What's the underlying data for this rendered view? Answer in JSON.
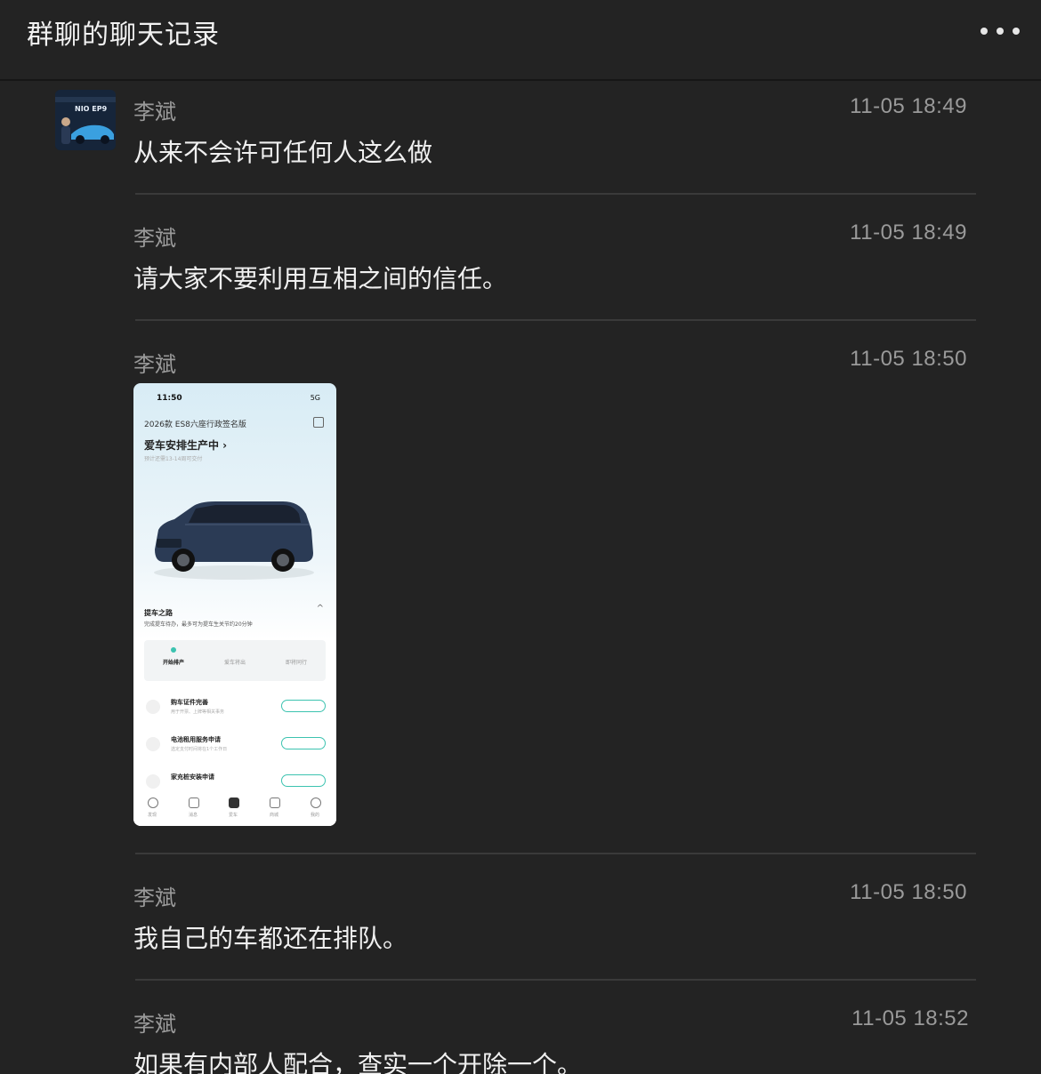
{
  "header": {
    "title": "群聊的聊天记录"
  },
  "messages": [
    {
      "sender": "李斌",
      "time": "11-05 18:49",
      "text": "从来不会许可任何人这么做"
    },
    {
      "sender": "李斌",
      "time": "11-05 18:49",
      "text": "请大家不要利用互相之间的信任。"
    },
    {
      "sender": "李斌",
      "time": "11-05 18:50",
      "image": {
        "status_time": "11:50",
        "network": "5G",
        "model": "2026款 ES8六座行政签名版",
        "order_status": "爱车安排生产中 ›",
        "eta": "预计还需13-14周可交付",
        "road_title": "提车之路",
        "road_subtitle": "完成提车待办，最多可为提车生关节约20分钟",
        "steps": [
          "开始排产",
          "爱车将出",
          "即将同行"
        ],
        "todos": [
          {
            "title": "购车证件完善",
            "subtitle": "用于开票、上牌等相关事务",
            "action": "去完善"
          },
          {
            "title": "电池租用服务申请",
            "subtitle": "选定支付时间将在1个工作日",
            "action": "去申请"
          },
          {
            "title": "家充桩安装申请",
            "subtitle": "",
            "action": "去申请"
          }
        ],
        "tabs": [
          "发现",
          "消息",
          "爱车",
          "商城",
          "我的"
        ]
      }
    },
    {
      "sender": "李斌",
      "time": "11-05 18:50",
      "text": "我自己的车都还在排队。"
    },
    {
      "sender": "李斌",
      "time": "11-05 18:52",
      "text": "如果有内部人配合，查实一个开除一个。"
    }
  ]
}
